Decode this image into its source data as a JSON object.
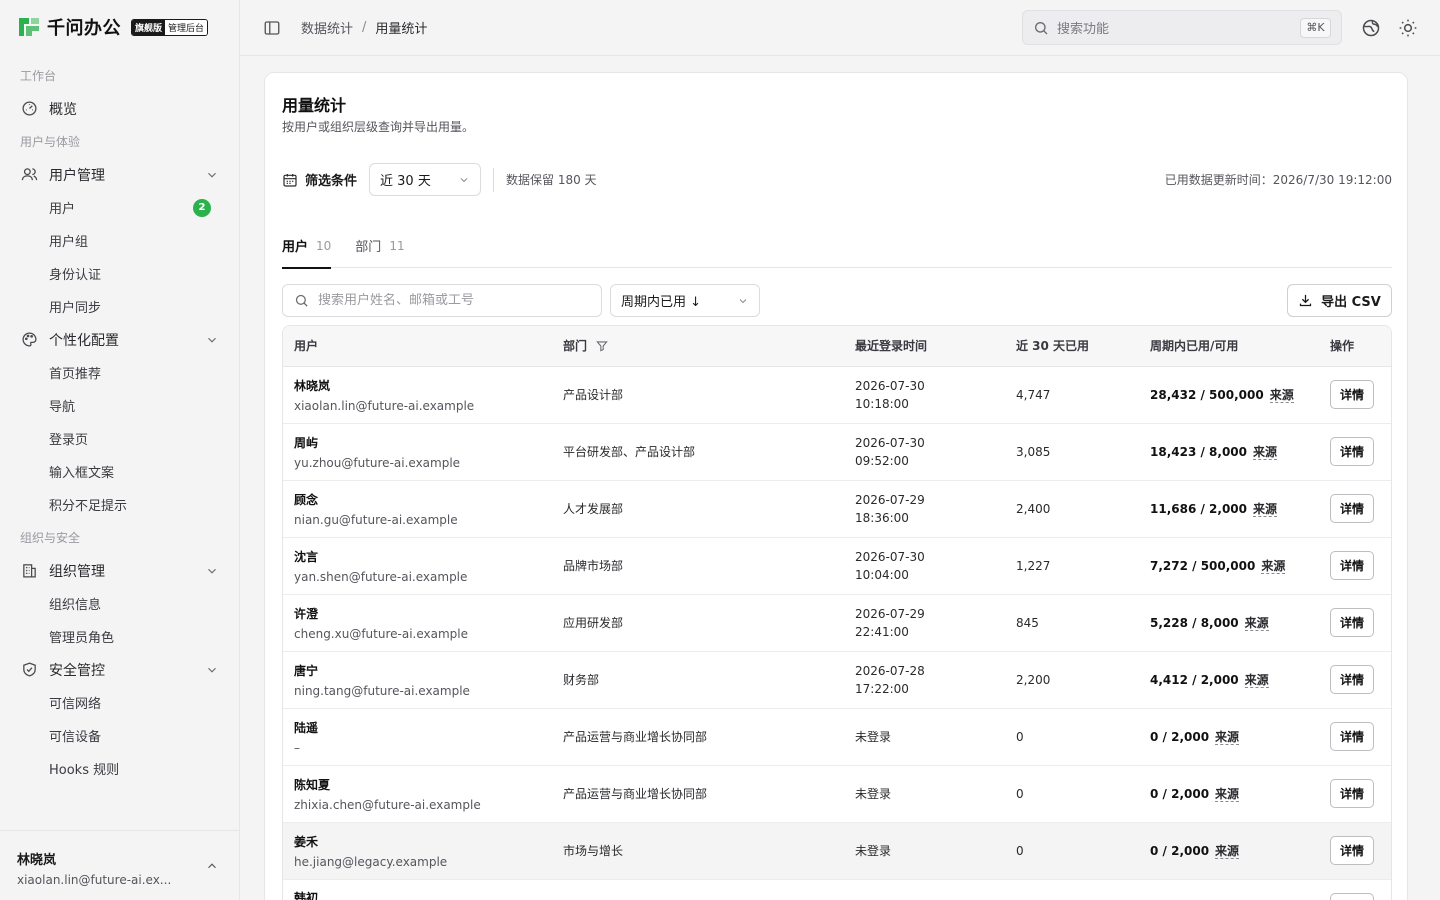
{
  "brand": {
    "name": "千问办公",
    "badge_primary": "旗舰版",
    "badge_secondary": "管理后台",
    "logo_color": "#2bb24c"
  },
  "sidebar": {
    "sections": [
      {
        "title": "工作台"
      },
      {
        "title": "用户与体验"
      },
      {
        "title": "组织与安全"
      }
    ],
    "overview": "概览",
    "user_mgmt": {
      "label": "用户管理",
      "items": [
        "用户",
        "用户组",
        "身份认证",
        "用户同步"
      ],
      "users_count": "2"
    },
    "personalize": {
      "label": "个性化配置",
      "items": [
        "首页推荐",
        "导航",
        "登录页",
        "输入框文案",
        "积分不足提示"
      ]
    },
    "org_mgmt": {
      "label": "组织管理",
      "items": [
        "组织信息",
        "管理员角色"
      ]
    },
    "security": {
      "label": "安全管控",
      "items": [
        "可信网络",
        "可信设备",
        "Hooks 规则"
      ]
    }
  },
  "current_user": {
    "name": "林晓岚",
    "email": "xiaolan.lin@future-ai.ex..."
  },
  "topbar": {
    "breadcrumb": [
      "数据统计",
      "用量统计"
    ],
    "search_placeholder": "搜索功能",
    "search_shortcut": "⌘K"
  },
  "page": {
    "title": "用量统计",
    "description": "按用户或组织层级查询并导出用量。",
    "filter_label": "筛选条件",
    "range_value": "近 30 天",
    "retention": "数据保留 180 天",
    "updated": "已用数据更新时间：2026/7/30 19:12:00"
  },
  "tabs": [
    {
      "label": "用户",
      "count": "10"
    },
    {
      "label": "部门",
      "count": "11"
    }
  ],
  "toolbar": {
    "search_placeholder": "搜索用户姓名、邮箱或工号",
    "sort_value": "周期内已用 ↓",
    "export_label": "导出 CSV"
  },
  "table": {
    "headers": [
      "用户",
      "部门",
      "最近登录时间",
      "近 30 天已用",
      "周期内已用/可用",
      "操作"
    ],
    "source_label": "来源",
    "detail_label": "详情",
    "rows": [
      {
        "name": "林晓岚",
        "email": "xiaolan.lin@future-ai.example",
        "dept": "产品设计部",
        "login_date": "2026-07-30",
        "login_time": "10:18:00",
        "used30": "4,747",
        "usage": "28,432 / 500,000"
      },
      {
        "name": "周屿",
        "email": "yu.zhou@future-ai.example",
        "dept": "平台研发部、产品设计部",
        "login_date": "2026-07-30",
        "login_time": "09:52:00",
        "used30": "3,085",
        "usage": "18,423 / 8,000"
      },
      {
        "name": "顾念",
        "email": "nian.gu@future-ai.example",
        "dept": "人才发展部",
        "login_date": "2026-07-29",
        "login_time": "18:36:00",
        "used30": "2,400",
        "usage": "11,686 / 2,000"
      },
      {
        "name": "沈言",
        "email": "yan.shen@future-ai.example",
        "dept": "品牌市场部",
        "login_date": "2026-07-30",
        "login_time": "10:04:00",
        "used30": "1,227",
        "usage": "7,272 / 500,000"
      },
      {
        "name": "许澄",
        "email": "cheng.xu@future-ai.example",
        "dept": "应用研发部",
        "login_date": "2026-07-29",
        "login_time": "22:41:00",
        "used30": "845",
        "usage": "5,228 / 8,000"
      },
      {
        "name": "唐宁",
        "email": "ning.tang@future-ai.example",
        "dept": "财务部",
        "login_date": "2026-07-28",
        "login_time": "17:22:00",
        "used30": "2,200",
        "usage": "4,412 / 2,000"
      },
      {
        "name": "陆遥",
        "email": "–",
        "dept": "产品运营与商业增长协同部",
        "login_date": "未登录",
        "login_time": "",
        "used30": "0",
        "usage": "0 / 2,000"
      },
      {
        "name": "陈知夏",
        "email": "zhixia.chen@future-ai.example",
        "dept": "产品运营与商业增长协同部",
        "login_date": "未登录",
        "login_time": "",
        "used30": "0",
        "usage": "0 / 2,000"
      },
      {
        "name": "姜禾",
        "email": "he.jiang@legacy.example",
        "dept": "市场与增长",
        "login_date": "未登录",
        "login_time": "",
        "used30": "0",
        "usage": "0 / 2,000"
      },
      {
        "name": "韩初",
        "email": "",
        "dept": "",
        "login_date": "",
        "login_time": "",
        "used30": "",
        "usage": ""
      }
    ]
  }
}
